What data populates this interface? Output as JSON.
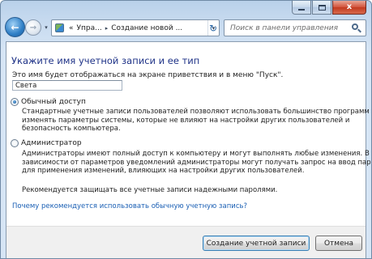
{
  "titlebar": {
    "minimize_icon": "minimize-icon",
    "maximize_icon": "maximize-icon",
    "close_glyph": "x",
    "close_color": "#c23a1f"
  },
  "nav": {
    "back_glyph": "←",
    "forward_glyph": "→",
    "dropdown_glyph": "▾",
    "address_prefix": "«",
    "breadcrumbs": [
      "Упра...",
      "Создание новой ..."
    ],
    "separator": "▸",
    "refresh_glyph": "↻",
    "search_placeholder": "Поиск в панели управления"
  },
  "form": {
    "title": "Укажите имя учетной записи и ее тип",
    "name_hint": "Это имя будет отображаться на экране приветствия и в меню \"Пуск\".",
    "name_value": "Света",
    "options": [
      {
        "label": "Обычный доступ",
        "checked": true,
        "description": [
          "Стандартные учетные записи пользователей позволяют использовать большинство программ и",
          "изменять параметры системы, которые не влияют на настройки других пользователей и",
          "безопасность компьютера."
        ]
      },
      {
        "label": "Администратор",
        "checked": false,
        "description": [
          "Администраторы имеют полный доступ к компьютеру и могут выполнять любые изменения. В",
          "зависимости от параметров уведомлений администраторы могут получать запрос на ввод пароля",
          "для применения изменений, влияющих на настройки других пользователей."
        ]
      }
    ],
    "recommendation": "Рекомендуется защищать все учетные записи надежными паролями.",
    "help_link": "Почему рекомендуется использовать обычную учетную запись?",
    "link_color": "#1a5fb4",
    "title_color": "#1e3287"
  },
  "footer": {
    "create_label": "Создание учетной записи",
    "cancel_label": "Отмена"
  }
}
